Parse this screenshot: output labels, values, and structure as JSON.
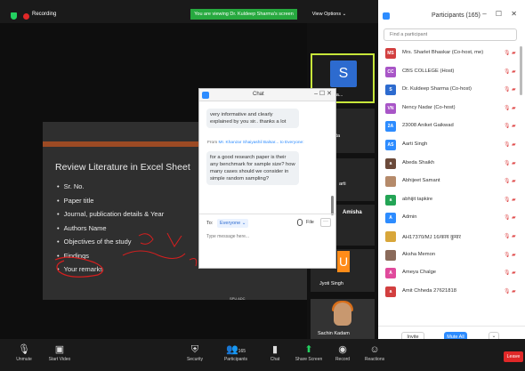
{
  "topbar": {
    "recording": "Recording",
    "viewing_banner": "You are viewing Dr. Kuldeep Sharma's screen",
    "view_options": "View Options ⌄"
  },
  "slide": {
    "title": "Review Literature in Excel Sheet",
    "items": [
      "Sr. No.",
      "Paper title",
      "Journal, publication details & Year",
      "Authors Name",
      "Objectives of the study",
      "Findings",
      "Your remarks"
    ],
    "presenter": "SPU ADC"
  },
  "thumbnails": {
    "s_letter": "S",
    "s_name": "Sha...",
    "t2_name": "Ekta",
    "t3_name": "arti",
    "t4_name": "Amisha",
    "u_letter": "U",
    "u_name": "Jyoti Singh",
    "photo_name": "Sachin Kadam"
  },
  "chat": {
    "title": "Chat",
    "controls": "– ☐ ✕",
    "msg1": "very informative and clearly explained by you sir.. thanks a lot",
    "from_prefix": "From",
    "from_name": "Mr. Khanzar Shaiyashil Balsar...",
    "from_suffix": "to Everyone:",
    "msg2": "for a good research paper is their any benchmark for sample size? how many cases should we consider in simple random sampling?",
    "to_label": "To:",
    "to_value": "Everyone ⌄",
    "file_label": "File",
    "more": "···",
    "input_placeholder": "Type message here..."
  },
  "participants": {
    "title": "Participants (165)",
    "controls": "– ☐ ✕",
    "search_placeholder": "Find a participant",
    "rows": [
      {
        "initials": "MS",
        "color": "#d23f3f",
        "name": "Mrs. Sharlet Bhaskar (Co-host, me)"
      },
      {
        "initials": "CC",
        "color": "#a855c7",
        "name": "CBS COLLEGE (Host)"
      },
      {
        "initials": "S",
        "color": "#2d6bcf",
        "name": "Dr. Kuldeep Sharma (Co-host)"
      },
      {
        "initials": "VN",
        "color": "#a855c7",
        "name": "Nency Nadar (Co-host)"
      },
      {
        "initials": "2A",
        "color": "#2d8cff",
        "name": "23008 Aniket Gaikwad"
      },
      {
        "initials": "AS",
        "color": "#2d8cff",
        "name": "Aarti Singh"
      },
      {
        "initials": "a",
        "color": "#6b4a3a",
        "name": "Abeda Shaikh"
      },
      {
        "initials": "",
        "color": "#b58a6a",
        "name": "Abhijeet Samant"
      },
      {
        "initials": "a",
        "color": "#23a455",
        "name": "abhijit tapkire"
      },
      {
        "initials": "A",
        "color": "#2d8cff",
        "name": "Admin"
      },
      {
        "initials": "",
        "color": "#d8a63a",
        "name": "AH17370/MJ 16/काय कुमार"
      },
      {
        "initials": "",
        "color": "#8a6a5a",
        "name": "Aksha Memon"
      },
      {
        "initials": "A",
        "color": "#e04a9c",
        "name": "Ameya Chalge"
      },
      {
        "initials": "a",
        "color": "#d23f3f",
        "name": "Amit Chheda 27621818"
      }
    ],
    "invite_label": "Invite",
    "mute_all_label": "Mute All",
    "more_label": "⌄"
  },
  "toolbar": {
    "unmute": "Unmute",
    "start_video": "Start Video",
    "security": "Security",
    "participants": "Participants",
    "participants_count": "165",
    "chat": "Chat",
    "share": "Share Screen",
    "record": "Record",
    "reactions": "Reactions",
    "leave": "Leave"
  }
}
